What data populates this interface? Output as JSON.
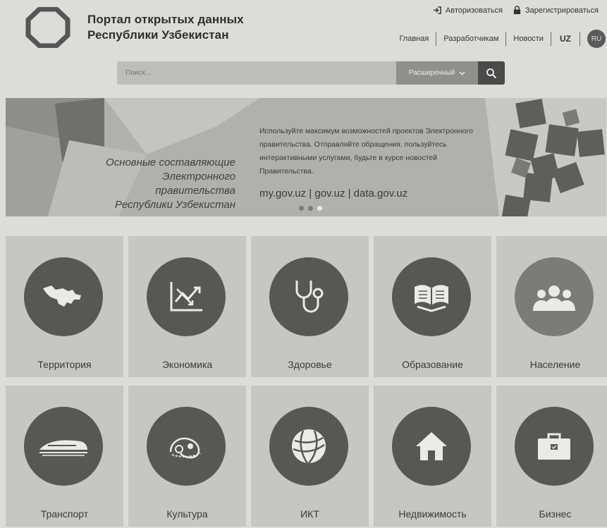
{
  "header": {
    "title_line1": "Портал открытых данных",
    "title_line2": "Республики Узбекистан",
    "login": "Авторизоваться",
    "register": "Зарегистрироваться",
    "nav": [
      "Главная",
      "Разработчикам",
      "Новости"
    ],
    "lang_uz": "UZ",
    "lang_ru": "RU"
  },
  "search": {
    "placeholder": "Поиск...",
    "advanced": "Расширенный"
  },
  "banner": {
    "caption_line1": "Основные составляющие",
    "caption_line2": "Электронного правительства",
    "caption_line3": "Республики Узбекистан",
    "text": "Используйте максимум возможностей проектов Электронного правительства. Отправляйте обращения, пользуйтесь интерактивными услугами, будьте в курсе новостей Правительства.",
    "links": "my.gov.uz | gov.uz | data.gov.uz",
    "slide_count": 3,
    "active_slide": 3
  },
  "categories": [
    {
      "label": "Территория",
      "icon": "map-icon"
    },
    {
      "label": "Экономика",
      "icon": "chart-icon"
    },
    {
      "label": "Здоровье",
      "icon": "stethoscope-icon"
    },
    {
      "label": "Образование",
      "icon": "book-icon"
    },
    {
      "label": "Население",
      "icon": "people-icon"
    },
    {
      "label": "Транспорт",
      "icon": "train-icon"
    },
    {
      "label": "Культура",
      "icon": "ornament-icon"
    },
    {
      "label": "ИКТ",
      "icon": "globe-icon"
    },
    {
      "label": "Недвижимость",
      "icon": "house-icon"
    },
    {
      "label": "Бизнес",
      "icon": "briefcase-icon"
    }
  ]
}
